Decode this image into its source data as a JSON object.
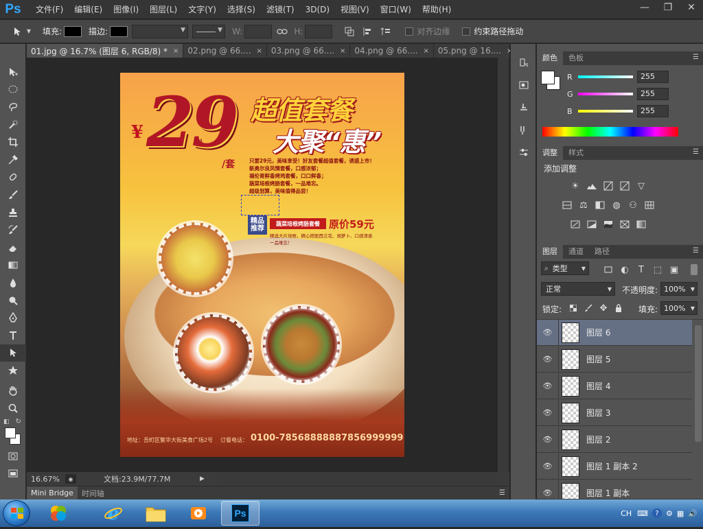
{
  "app": {
    "logo": "Ps"
  },
  "menu": [
    "文件(F)",
    "编辑(E)",
    "图像(I)",
    "图层(L)",
    "文字(Y)",
    "选择(S)",
    "滤镜(T)",
    "3D(D)",
    "视图(V)",
    "窗口(W)",
    "帮助(H)"
  ],
  "window_controls": {
    "minimize": "—",
    "restore": "❐",
    "close": "✕"
  },
  "options": {
    "fill_label": "填充:",
    "stroke_label": "描边:",
    "w_label": "W:",
    "h_label": "H:",
    "align_edges": "对齐边缘",
    "constrain_path": "约束路径拖动",
    "fill_color": "#000000",
    "stroke_color": "#000000"
  },
  "tabs": [
    {
      "label": "01.jpg @ 16.7% (图层 6, RGB/8) *",
      "active": true
    },
    {
      "label": "02.png @ 66....",
      "active": false
    },
    {
      "label": "03.png @ 66....",
      "active": false
    },
    {
      "label": "04.png @ 66....",
      "active": false
    },
    {
      "label": "05.png @ 16....",
      "active": false
    }
  ],
  "tab_close": "×",
  "status": {
    "zoom": "16.67%",
    "doc": "文档:23.9M/77.7M"
  },
  "bottom_tabs": [
    "Mini Bridge",
    "时间轴"
  ],
  "poster": {
    "yen": "¥",
    "price": "29",
    "unit": "/套",
    "headline1": "超值套餐",
    "headline2": "大聚“惠”",
    "promo_lines": [
      "只要29元，美味享受！好友套餐超值套餐，诱惑上市！",
      "新奥尔良风情套餐，口感浓郁；",
      "福伦哥鲜香烤鸡套餐，口口鲜香；",
      "蔬菜培根烤肠套餐，一品难忘。",
      "超级划算，美味值得品尝！"
    ],
    "recommend": "精品\n推荐",
    "recommend_bar": "蔬菜培根烤肠套餐",
    "orig_price": "原价59元",
    "dish_desc1": "精选大片培根，精心搭配西兰花、胡萝卜、口感清香",
    "dish_desc2": "一品难忘！",
    "address": "地址：吾町区繁华大街美食广场2号",
    "phone_label": "订餐电话：",
    "phone1": "0100-7856888888",
    "phone2": "7856999999"
  },
  "color_panel": {
    "tabs": [
      "颜色",
      "色板"
    ],
    "sliders": [
      {
        "label": "R",
        "value": "255",
        "gradient": "linear-gradient(90deg,#00ffff,#ffffff)"
      },
      {
        "label": "G",
        "value": "255",
        "gradient": "linear-gradient(90deg,#ff00ff,#ffffff)"
      },
      {
        "label": "B",
        "value": "255",
        "gradient": "linear-gradient(90deg,#ffff00,#ffffff)"
      }
    ]
  },
  "adjust_panel": {
    "tabs": [
      "调整",
      "样式"
    ],
    "title": "添加调整"
  },
  "layers_panel": {
    "tabs": [
      "图层",
      "通道",
      "路径"
    ],
    "filter_label": "类型",
    "blend_mode": "正常",
    "opacity_label": "不透明度:",
    "opacity": "100%",
    "lock_label": "锁定:",
    "fill_label": "填充:",
    "fill": "100%",
    "layers": [
      {
        "name": "图层 6",
        "selected": true
      },
      {
        "name": "图层 5",
        "selected": false
      },
      {
        "name": "图层 4",
        "selected": false
      },
      {
        "name": "图层 3",
        "selected": false
      },
      {
        "name": "图层 2",
        "selected": false
      },
      {
        "name": "图层 1 副本 2",
        "selected": false
      },
      {
        "name": "图层 1 副本",
        "selected": false
      }
    ]
  },
  "tray": {
    "lang": "CH"
  },
  "colors": {
    "accent": "#31a8ff",
    "selected_layer": "#657085",
    "poster_red": "#b11626"
  }
}
